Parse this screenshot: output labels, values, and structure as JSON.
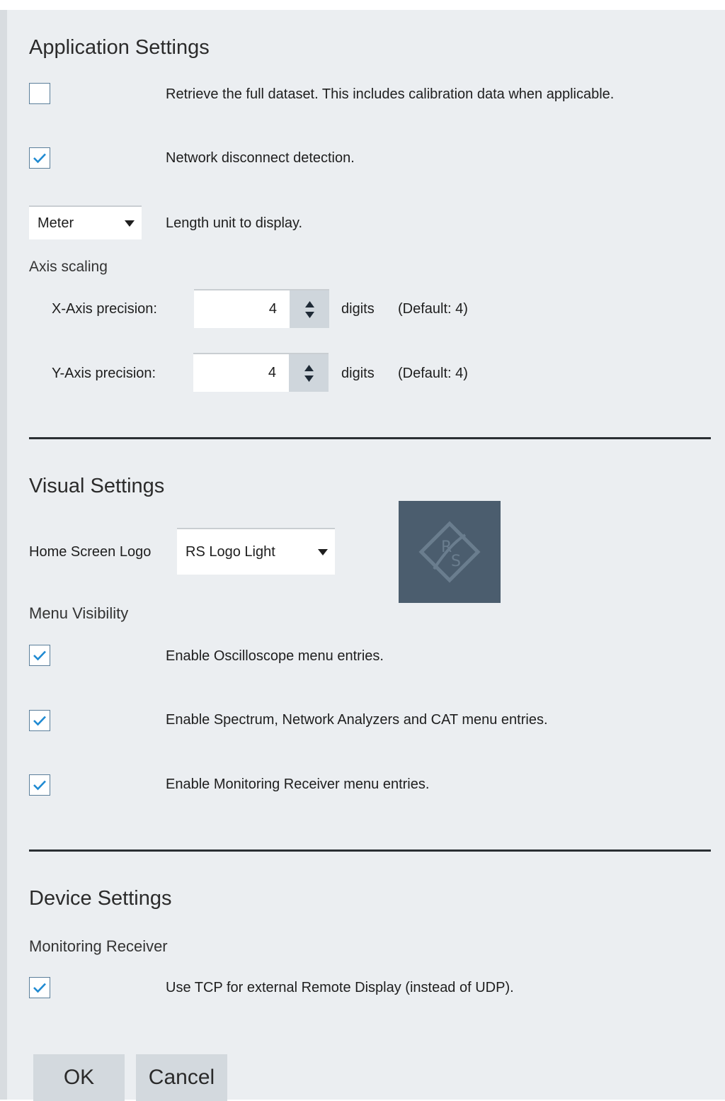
{
  "application_settings": {
    "heading": "Application Settings",
    "full_dataset": {
      "label": "Retrieve the full dataset. This includes calibration data when applicable.",
      "checked": false
    },
    "network_disconnect": {
      "label": "Network disconnect detection.",
      "checked": true
    },
    "length_unit": {
      "selected": "Meter",
      "label": "Length unit to display."
    },
    "axis_scaling": {
      "label": "Axis scaling",
      "x_axis": {
        "label": "X-Axis precision:",
        "value": "4",
        "unit": "digits",
        "default": "(Default: 4)"
      },
      "y_axis": {
        "label": "Y-Axis precision:",
        "value": "4",
        "unit": "digits",
        "default": "(Default: 4)"
      }
    }
  },
  "visual_settings": {
    "heading": "Visual Settings",
    "home_logo": {
      "label": "Home Screen Logo",
      "selected": "RS Logo Light"
    },
    "logo_preview": {
      "letters": "RS"
    },
    "menu_visibility": {
      "label": "Menu Visibility",
      "oscilloscope": {
        "label": "Enable Oscilloscope menu entries.",
        "checked": true
      },
      "spectrum": {
        "label": "Enable Spectrum, Network Analyzers and CAT menu entries.",
        "checked": true
      },
      "monitoring": {
        "label": "Enable Monitoring Receiver menu entries.",
        "checked": true
      }
    }
  },
  "device_settings": {
    "heading": "Device Settings",
    "monitoring_receiver": {
      "label": "Monitoring Receiver",
      "use_tcp": {
        "label": "Use TCP for external Remote Display (instead of UDP).",
        "checked": true
      }
    }
  },
  "buttons": {
    "ok": "OK",
    "cancel": "Cancel"
  },
  "colors": {
    "check": "#1f8ad2",
    "panel_bg": "#ebeef1",
    "logo_bg": "#4b5d6e"
  }
}
